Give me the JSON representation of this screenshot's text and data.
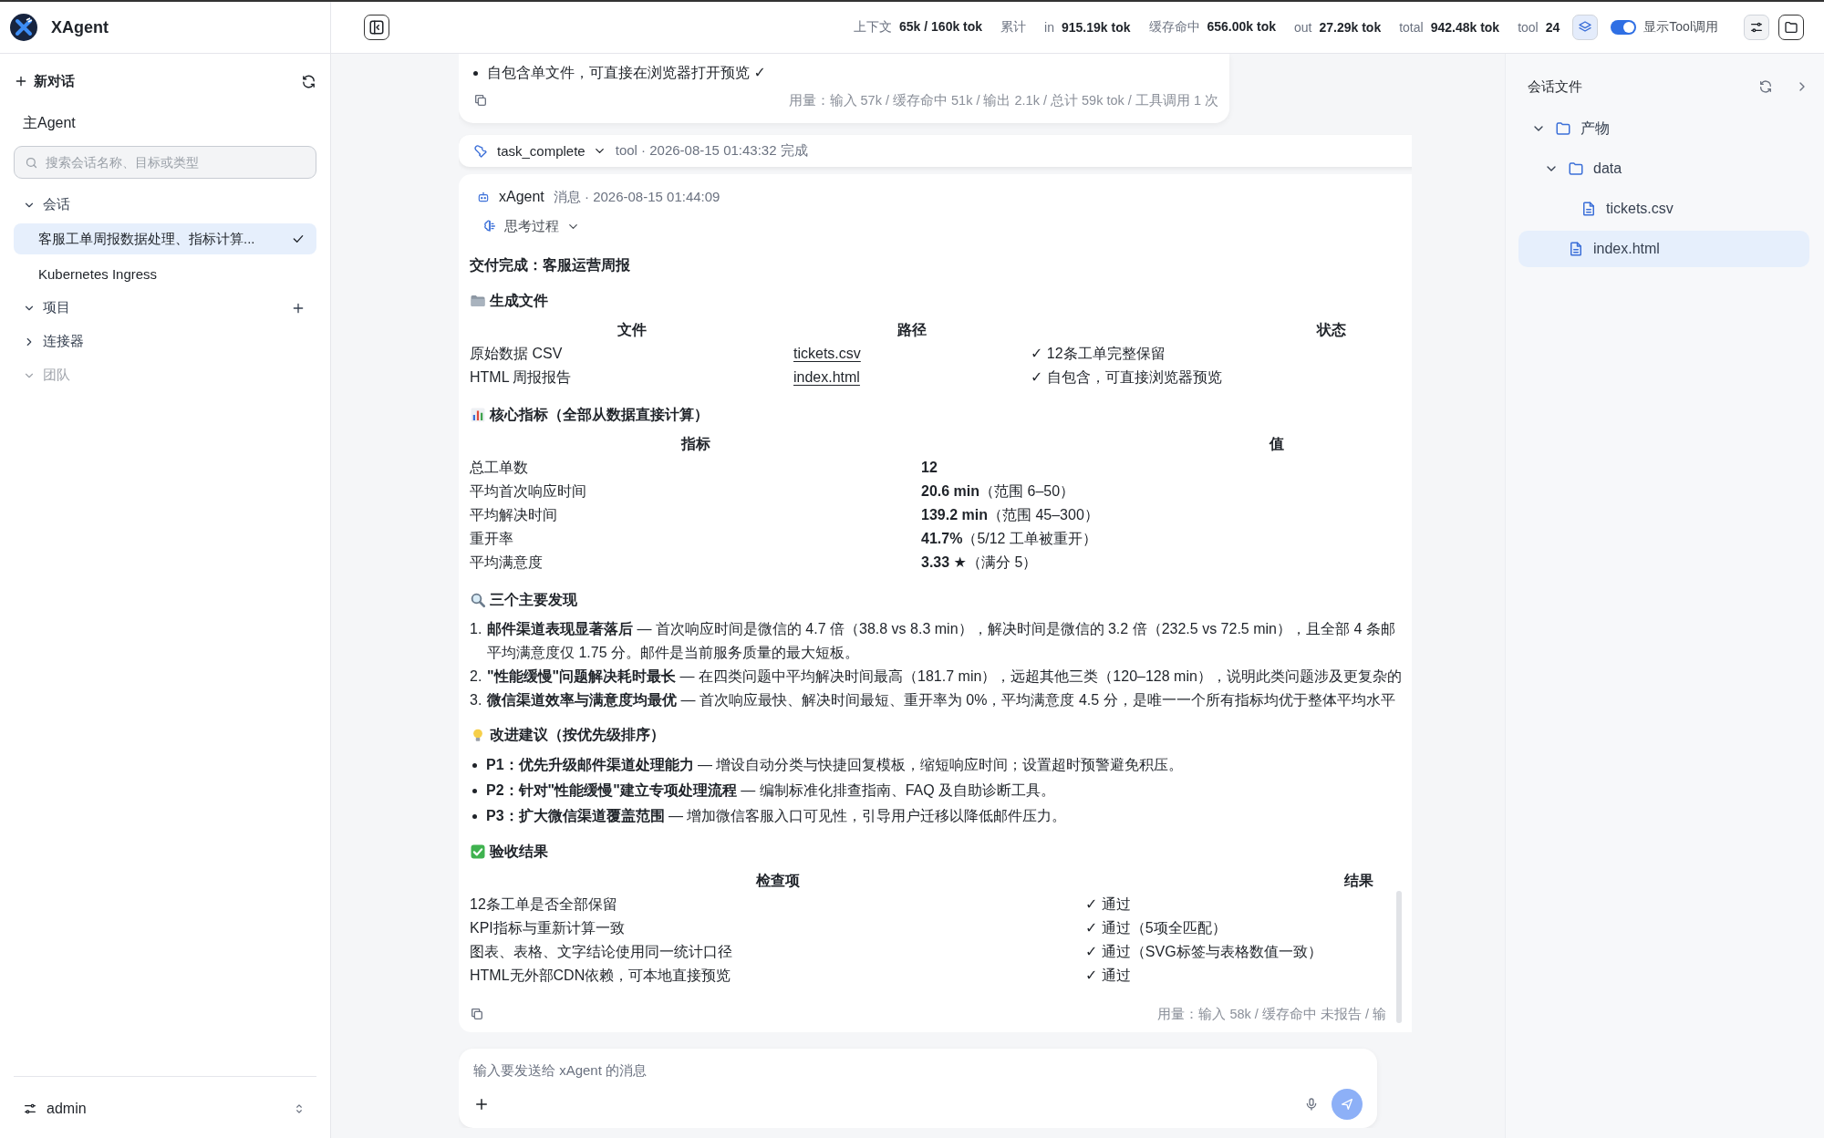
{
  "app": {
    "name": "XAgent"
  },
  "sidebar": {
    "new_chat": "新对话",
    "agent": "主Agent",
    "search": {
      "placeholder": "搜索会话名称、目标或类型"
    },
    "groups": [
      {
        "label": "会话",
        "expanded": true,
        "disabled": false,
        "has_add": false,
        "items": [
          {
            "label": "客服工单周报数据处理、指标计算...",
            "selected": true
          },
          {
            "label": "Kubernetes Ingress",
            "selected": false
          }
        ]
      },
      {
        "label": "项目",
        "expanded": true,
        "disabled": false,
        "has_add": true
      },
      {
        "label": "连接器",
        "expanded": false,
        "disabled": false,
        "has_add": false
      },
      {
        "label": "团队",
        "expanded": true,
        "disabled": true,
        "has_add": false
      }
    ],
    "user": "admin"
  },
  "topbar": {
    "stats": [
      {
        "label": "上下文",
        "value": "65k / 160k tok"
      },
      {
        "label": "累计"
      },
      {
        "label": "in",
        "value": "915.19k tok"
      },
      {
        "label": "缓存命中",
        "value": "656.00k tok"
      },
      {
        "label": "out",
        "value": "27.29k tok"
      },
      {
        "label": "total",
        "value": "942.48k tok"
      },
      {
        "label": "tool",
        "value": "24"
      }
    ],
    "layers_active": true,
    "toggle": {
      "label": "显示Tool调用",
      "on": true
    }
  },
  "chat": {
    "previous": {
      "bullets": [
        "自包含单文件，可直接在浏览器打开预览 ✓"
      ],
      "usage": "用量：输入 57k / 缓存命中 51k / 输出 2.1k / 总计 59k tok / 工具调用 1 次"
    },
    "tool_call": {
      "name": "task_complete",
      "meta": "tool · 2026-08-15 01:43:32 完成",
      "expanded": false
    },
    "message": {
      "author": "xAgent",
      "meta": "消息 · 2026-08-15 01:44:09",
      "thinking": {
        "label": "思考过程",
        "expanded": false
      },
      "title": "交付完成：客服运营周报",
      "sections": [
        {
          "heading": "生成文件",
          "kind": "table",
          "columns": [
            "文件",
            "路径",
            "状态"
          ],
          "rows": [
            [
              "原始数据 CSV",
              {
                "text": "tickets.csv",
                "kind": "link"
              },
              "✓ 12条工单完整保留"
            ],
            [
              "HTML 周报报告",
              {
                "text": "index.html",
                "kind": "link"
              },
              "✓ 自包含，可直接浏览器预览"
            ]
          ]
        },
        {
          "heading": "核心指标（全部从数据直接计算）",
          "kind": "table",
          "columns": [
            "指标",
            "值"
          ],
          "rows": [
            [
              "总工单数",
              {
                "text": "12",
                "kind": "strong"
              }
            ],
            [
              "平均首次响应时间",
              {
                "text": "20.6 min",
                "note": "（范围 6–50）",
                "kind": "strong"
              }
            ],
            [
              "平均解决时间",
              {
                "text": "139.2 min",
                "note": "（范围 45–300）",
                "kind": "strong"
              }
            ],
            [
              "重开率",
              {
                "text": "41.7%",
                "note": "（5/12 工单被重开）",
                "kind": "strong"
              }
            ],
            [
              "平均满意度",
              {
                "text": "3.33 ★",
                "note": "（满分 5）",
                "kind": "strong"
              }
            ]
          ]
        },
        {
          "heading": "三个主要发现",
          "kind": "ordered",
          "items": [
            {
              "number": "1.",
              "title": "邮件渠道表现显著落后",
              "text": " — 首次响应时间是微信的 4.7 倍（38.8 vs 8.3 min），解决时间是微信的 3.2 倍（232.5 vs 72.5 min），且全部 4 条邮",
              "continuation": "平均满意度仅 1.75 分。邮件是当前服务质量的最大短板。"
            },
            {
              "number": "2.",
              "title": "\"性能缓慢\"问题解决耗时最长",
              "text": " — 在四类问题中平均解决时间最高（181.7 min），远超其他三类（120–128 min），说明此类问题涉及更复杂的"
            },
            {
              "number": "3.",
              "title": "微信渠道效率与满意度均最优",
              "text": " — 首次响应最快、解决时间最短、重开率为 0%，平均满意度 4.5 分，是唯一一个所有指标均优于整体平均水平"
            }
          ]
        },
        {
          "heading": "改进建议（按优先级排序）",
          "kind": "bullets",
          "items": [
            {
              "title": "P1：优先升级邮件渠道处理能力",
              "text": " — 增设自动分类与快捷回复模板，缩短响应时间；设置超时预警避免积压。"
            },
            {
              "title": "P2：针对\"性能缓慢\"建立专项处理流程",
              "text": " — 编制标准化排查指南、FAQ 及自助诊断工具。"
            },
            {
              "title": "P3：扩大微信渠道覆盖范围",
              "text": " — 增加微信客服入口可见性，引导用户迁移以降低邮件压力。"
            }
          ]
        },
        {
          "heading": "验收结果",
          "kind": "table",
          "columns": [
            "检查项",
            "结果"
          ],
          "rows": [
            [
              "12条工单是否全部保留",
              "✓ 通过"
            ],
            [
              "KPI指标与重新计算一致",
              "✓ 通过（5项全匹配）"
            ],
            [
              "图表、表格、文字结论使用同一统计口径",
              "✓ 通过（SVG标签与表格数值一致）"
            ],
            [
              "HTML无外部CDN依赖，可本地直接预览",
              "✓ 通过"
            ]
          ]
        }
      ],
      "usage": "用量：输入 58k / 缓存命中 未报告 / 输"
    },
    "composer": {
      "placeholder": "输入要发送给 xAgent 的消息"
    }
  },
  "files_panel": {
    "title": "会话文件",
    "tree": [
      {
        "name": "产物",
        "kind": "folder",
        "expanded": true,
        "selected": false,
        "children": [
          {
            "name": "data",
            "kind": "folder",
            "expanded": true,
            "selected": false,
            "children": [
              {
                "name": "tickets.csv",
                "kind": "file",
                "selected": false
              }
            ]
          },
          {
            "name": "index.html",
            "kind": "file",
            "selected": true
          }
        ]
      }
    ]
  }
}
